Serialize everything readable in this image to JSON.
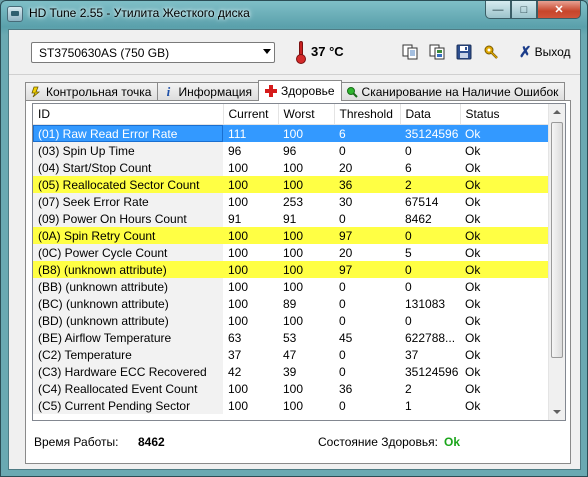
{
  "window": {
    "title": "HD Tune 2.55 - Утилита Жесткого диска",
    "caption_buttons": [
      "minimize-icon",
      "maximize-icon",
      "close-icon"
    ]
  },
  "toolbar": {
    "drive": "ST3750630AS (750 GB)",
    "temperature": "37 °C",
    "exit_label": "Выход",
    "icons": [
      "copy-icon",
      "copy-info-icon",
      "save-icon",
      "options-icon"
    ]
  },
  "tabs": [
    {
      "label": "Контрольная точка",
      "icon": "benchmark-icon",
      "active": false
    },
    {
      "label": "Информация",
      "icon": "info-icon",
      "active": false
    },
    {
      "label": "Здоровье",
      "icon": "health-cross-icon",
      "active": true
    },
    {
      "label": "Сканирование на Наличие Ошибок",
      "icon": "scan-magnifier-icon",
      "active": false
    }
  ],
  "table": {
    "columns": [
      "ID",
      "Current",
      "Worst",
      "Threshold",
      "Data",
      "Status"
    ],
    "rows": [
      {
        "id": "(01) Raw Read Error Rate",
        "current": "111",
        "worst": "100",
        "threshold": "6",
        "data": "35124596",
        "status": "Ok",
        "state": "selected"
      },
      {
        "id": "(03) Spin Up Time",
        "current": "96",
        "worst": "96",
        "threshold": "0",
        "data": "0",
        "status": "Ok",
        "state": "normal"
      },
      {
        "id": "(04) Start/Stop Count",
        "current": "100",
        "worst": "100",
        "threshold": "20",
        "data": "6",
        "status": "Ok",
        "state": "normal"
      },
      {
        "id": "(05) Reallocated Sector Count",
        "current": "100",
        "worst": "100",
        "threshold": "36",
        "data": "2",
        "status": "Ok",
        "state": "highlight"
      },
      {
        "id": "(07) Seek Error Rate",
        "current": "100",
        "worst": "253",
        "threshold": "30",
        "data": "67514",
        "status": "Ok",
        "state": "normal"
      },
      {
        "id": "(09) Power On Hours Count",
        "current": "91",
        "worst": "91",
        "threshold": "0",
        "data": "8462",
        "status": "Ok",
        "state": "normal"
      },
      {
        "id": "(0A) Spin Retry Count",
        "current": "100",
        "worst": "100",
        "threshold": "97",
        "data": "0",
        "status": "Ok",
        "state": "highlight"
      },
      {
        "id": "(0C) Power Cycle Count",
        "current": "100",
        "worst": "100",
        "threshold": "20",
        "data": "5",
        "status": "Ok",
        "state": "normal"
      },
      {
        "id": "(B8) (unknown attribute)",
        "current": "100",
        "worst": "100",
        "threshold": "97",
        "data": "0",
        "status": "Ok",
        "state": "highlight"
      },
      {
        "id": "(BB) (unknown attribute)",
        "current": "100",
        "worst": "100",
        "threshold": "0",
        "data": "0",
        "status": "Ok",
        "state": "normal"
      },
      {
        "id": "(BC) (unknown attribute)",
        "current": "100",
        "worst": "89",
        "threshold": "0",
        "data": "131083",
        "status": "Ok",
        "state": "normal"
      },
      {
        "id": "(BD) (unknown attribute)",
        "current": "100",
        "worst": "100",
        "threshold": "0",
        "data": "0",
        "status": "Ok",
        "state": "normal"
      },
      {
        "id": "(BE) Airflow Temperature",
        "current": "63",
        "worst": "53",
        "threshold": "45",
        "data": "622788...",
        "status": "Ok",
        "state": "normal"
      },
      {
        "id": "(C2) Temperature",
        "current": "37",
        "worst": "47",
        "threshold": "0",
        "data": "37",
        "status": "Ok",
        "state": "normal"
      },
      {
        "id": "(C3) Hardware ECC Recovered",
        "current": "42",
        "worst": "39",
        "threshold": "0",
        "data": "35124596",
        "status": "Ok",
        "state": "normal"
      },
      {
        "id": "(C4) Reallocated Event Count",
        "current": "100",
        "worst": "100",
        "threshold": "36",
        "data": "2",
        "status": "Ok",
        "state": "normal"
      },
      {
        "id": "(C5) Current Pending Sector",
        "current": "100",
        "worst": "100",
        "threshold": "0",
        "data": "1",
        "status": "Ok",
        "state": "normal"
      }
    ]
  },
  "status_bar": {
    "uptime_label": "Время Работы:",
    "uptime_value": "8462",
    "health_label": "Состояние Здоровья:",
    "health_value": "Ok"
  },
  "colors": {
    "highlight_row": "#ffff44",
    "selected_row": "#3399ff",
    "health_ok": "#1aa51a",
    "temperature_icon": "#d42a2a"
  }
}
